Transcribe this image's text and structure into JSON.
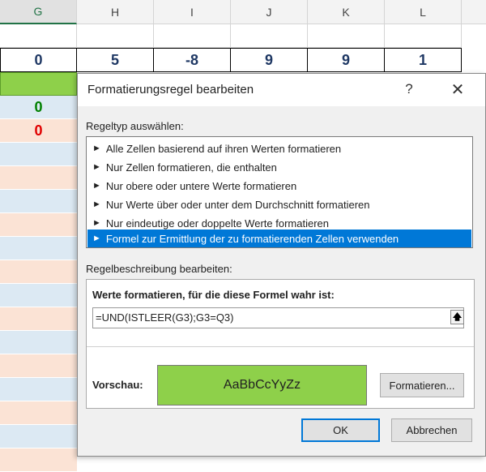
{
  "spreadsheet": {
    "columns": [
      "G",
      "H",
      "I",
      "J",
      "K",
      "L"
    ],
    "row3_values": [
      "0",
      "5",
      "-8",
      "9",
      "9",
      "1"
    ],
    "g_cells": [
      "0",
      "0"
    ],
    "colors": {
      "green_fill": "#8ed04a",
      "blue_fill": "#dce9f3",
      "orange_fill": "#fbe3d5",
      "value_blue": "#1f3864",
      "green_text": "#008000",
      "red_text": "#e00000"
    }
  },
  "dialog": {
    "title": "Formatierungsregel bearbeiten",
    "help_icon": "?",
    "close_icon": "✕",
    "rule_type_label": "Regeltyp auswählen:",
    "rule_types": [
      "Alle Zellen basierend auf ihren Werten formatieren",
      "Nur Zellen formatieren, die enthalten",
      "Nur obere oder untere Werte formatieren",
      "Nur Werte über oder unter dem Durchschnitt formatieren",
      "Nur eindeutige oder doppelte Werte formatieren",
      "Formel zur Ermittlung der zu formatierenden Zellen verwenden"
    ],
    "selected_rule_index": 5,
    "description_label": "Regelbeschreibung bearbeiten:",
    "formula_label": "Werte formatieren, für die diese Formel wahr ist:",
    "formula_value": "=UND(ISTLEER(G3);G3=Q3)",
    "preview_label": "Vorschau:",
    "preview_text": "AaBbCcYyZz",
    "format_button": "Formatieren...",
    "ok_button": "OK",
    "cancel_button": "Abbrechen",
    "colors": {
      "selection": "#0078d7",
      "preview_fill": "#8ed04a"
    }
  }
}
